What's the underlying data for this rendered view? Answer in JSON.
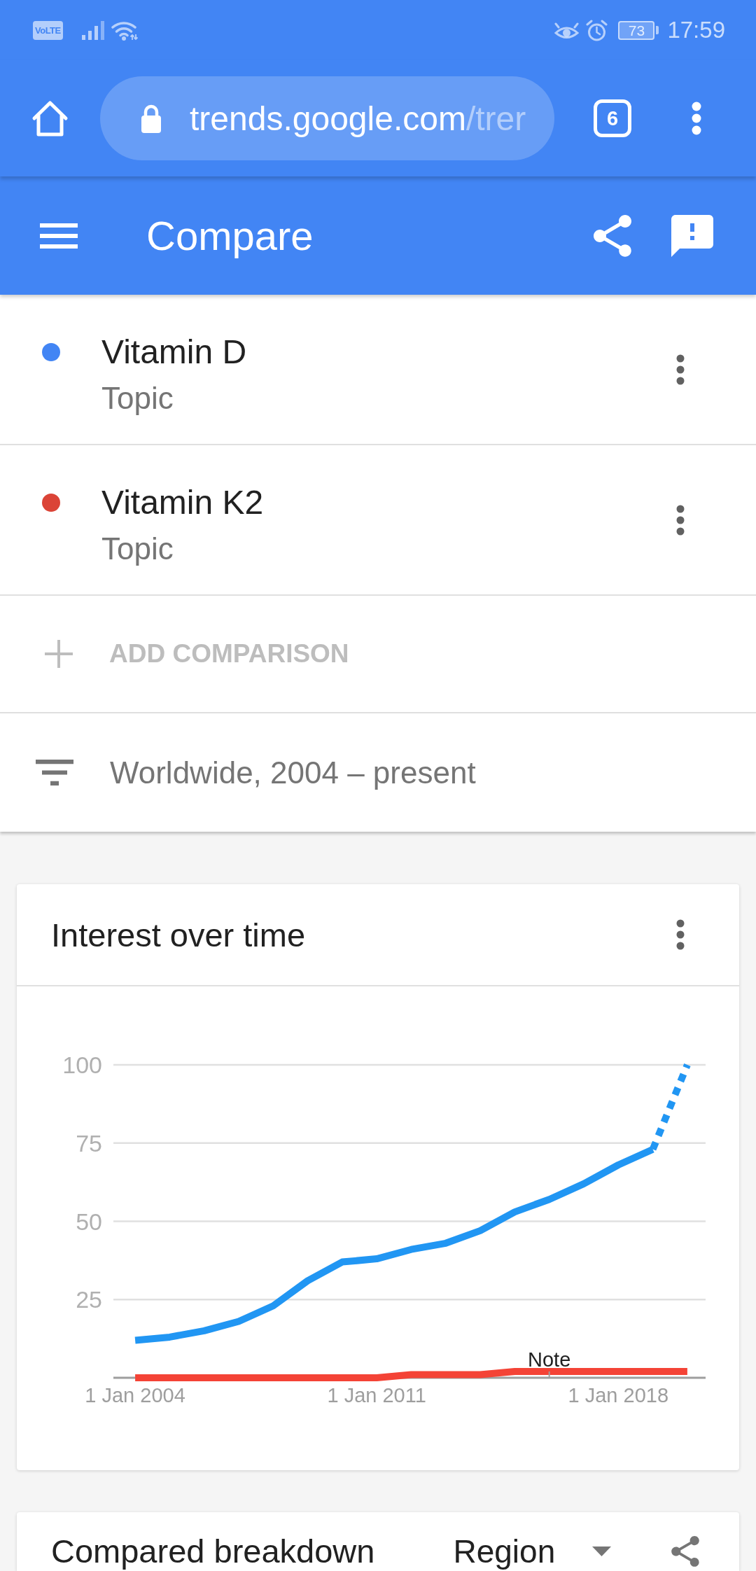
{
  "status_bar": {
    "network_badge": "VoLTE",
    "battery": "73",
    "time": "17:59"
  },
  "browser": {
    "url_host": "trends.google.com",
    "url_path": "/trer",
    "tab_count": "6"
  },
  "header": {
    "title": "Compare"
  },
  "terms": [
    {
      "name": "Vitamin D",
      "type": "Topic",
      "color": "#4285f4"
    },
    {
      "name": "Vitamin K2",
      "type": "Topic",
      "color": "#db4437"
    }
  ],
  "add_comparison": {
    "label": "ADD COMPARISON"
  },
  "filter": {
    "label": "Worldwide, 2004 – present"
  },
  "interest_card": {
    "title": "Interest over time",
    "chart_data": {
      "type": "line",
      "categories": [
        "1 Jan 2004",
        null,
        null,
        null,
        null,
        null,
        null,
        "1 Jan 2011",
        null,
        null,
        null,
        null,
        null,
        null,
        "1 Jan 2018",
        null,
        null
      ],
      "ylim": [
        0,
        100
      ],
      "yticks": [
        25,
        50,
        75,
        100
      ],
      "grid": true,
      "series": [
        {
          "color": "#2196f3",
          "values": [
            12,
            13,
            15,
            18,
            23,
            31,
            37,
            38,
            41,
            43,
            47,
            53,
            57,
            62,
            68,
            73,
            null
          ]
        },
        {
          "color": "#2196f3",
          "line_style": "dashed",
          "values": [
            null,
            null,
            null,
            null,
            null,
            null,
            null,
            null,
            null,
            null,
            null,
            null,
            null,
            null,
            null,
            73,
            100
          ]
        },
        {
          "color": "#f44336",
          "values": [
            0,
            0,
            0,
            0,
            0,
            0,
            0,
            0,
            1,
            1,
            1,
            2,
            2,
            2,
            2,
            2,
            2
          ]
        }
      ],
      "annotations": [
        "Note"
      ]
    }
  },
  "breakdown_card": {
    "title": "Compared breakdown",
    "dropdown": "Region"
  }
}
